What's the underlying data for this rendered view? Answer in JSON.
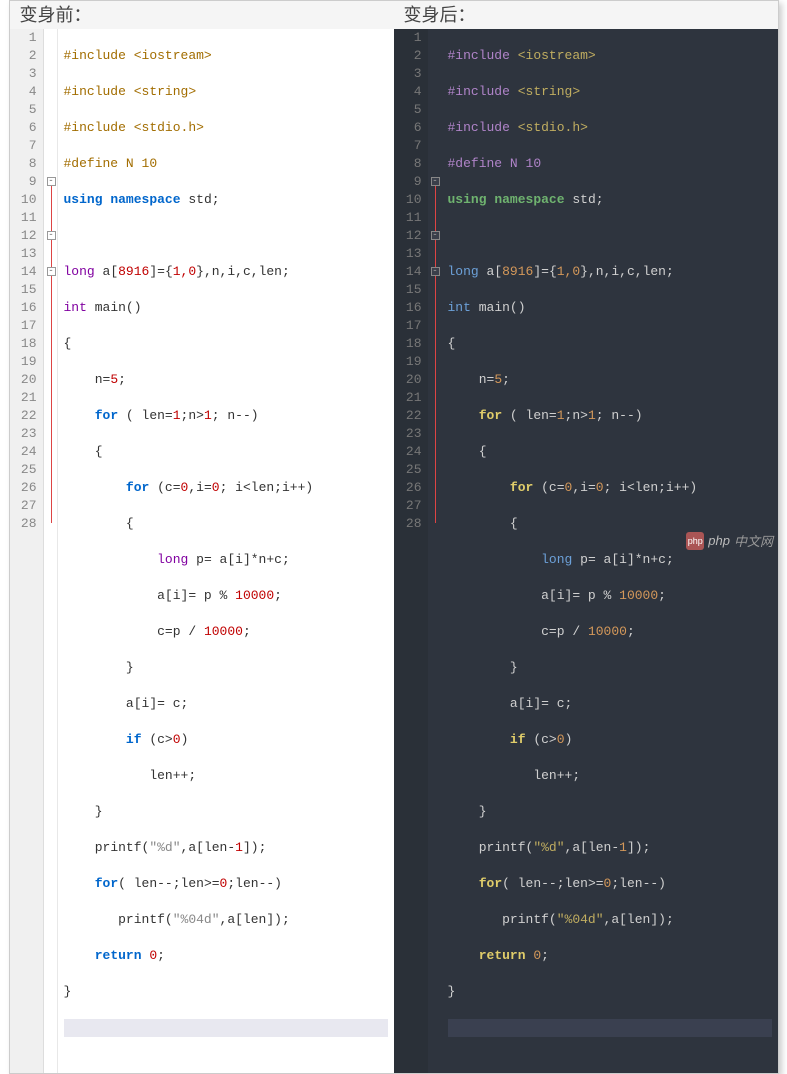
{
  "left_title": "变身前：",
  "right_title": "变身后：",
  "lines": [
    "1",
    "2",
    "3",
    "4",
    "5",
    "6",
    "7",
    "8",
    "9",
    "10",
    "11",
    "12",
    "13",
    "14",
    "15",
    "16",
    "17",
    "18",
    "19",
    "20",
    "21",
    "22",
    "23",
    "24",
    "25",
    "26",
    "27",
    "28"
  ],
  "code": {
    "l1": {
      "pre": "#include ",
      "inc": "<iostream>"
    },
    "l2": {
      "pre": "#include ",
      "inc": "<string>"
    },
    "l3": {
      "pre": "#include ",
      "inc": "<stdio.h>"
    },
    "l4": {
      "pre": "#define N ",
      "val": "10"
    },
    "l5": {
      "kw": "using ",
      "ns": "namespace",
      "sp": " ",
      "id": "std",
      ";": ";"
    },
    "l7": {
      "ty": "long ",
      "id": "a[",
      "num": "8916",
      "br": "]={",
      "v": "1,0",
      "b2": "},n,i,c,len;"
    },
    "l8": {
      "ty": "int ",
      "id": "main()"
    },
    "l9": {
      "t": "{"
    },
    "l10_a": "n=",
    "l10_b": "5",
    "l10_c": ";",
    "l11_a": "for",
    "l11_b": " ( len=",
    "l11_c": "1",
    "l11_d": ";n>",
    "l11_e": "1",
    "l11_f": "; n--)",
    "l12": "{",
    "l13_a": "for",
    "l13_b": " (c=",
    "l13_c": "0",
    "l13_d": ",i=",
    "l13_e": "0",
    "l13_f": "; i<len;i++)",
    "l14": "{",
    "l15_a": "long ",
    "l15_b": "p= a[i]*n+c;",
    "l16_a": "a[i]= p % ",
    "l16_b": "10000",
    "l16_c": ";",
    "l17_a": "c=p / ",
    "l17_b": "10000",
    "l17_c": ";",
    "l18": "}",
    "l19": "a[i]= c;",
    "l20_a": "if",
    "l20_b": " (c>",
    "l20_c": "0",
    "l20_d": ")",
    "l21": "len++;",
    "l22": "}",
    "l23_a": "printf(",
    "l23_b": "\"%d\"",
    "l23_c": ",a[len-",
    "l23_d": "1",
    "l23_e": "]);",
    "l24_a": "for",
    "l24_b": "( len--;len>=",
    "l24_c": "0",
    "l24_d": ";len--)",
    "l25_a": "printf(",
    "l25_b": "\"%04d\"",
    "l25_c": ",a[len]);",
    "l26_a": "return ",
    "l26_b": "0",
    "l26_c": ";",
    "l27": "}"
  },
  "watermark": {
    "logo": "php",
    "text1": "php",
    "text2": "中文网"
  }
}
